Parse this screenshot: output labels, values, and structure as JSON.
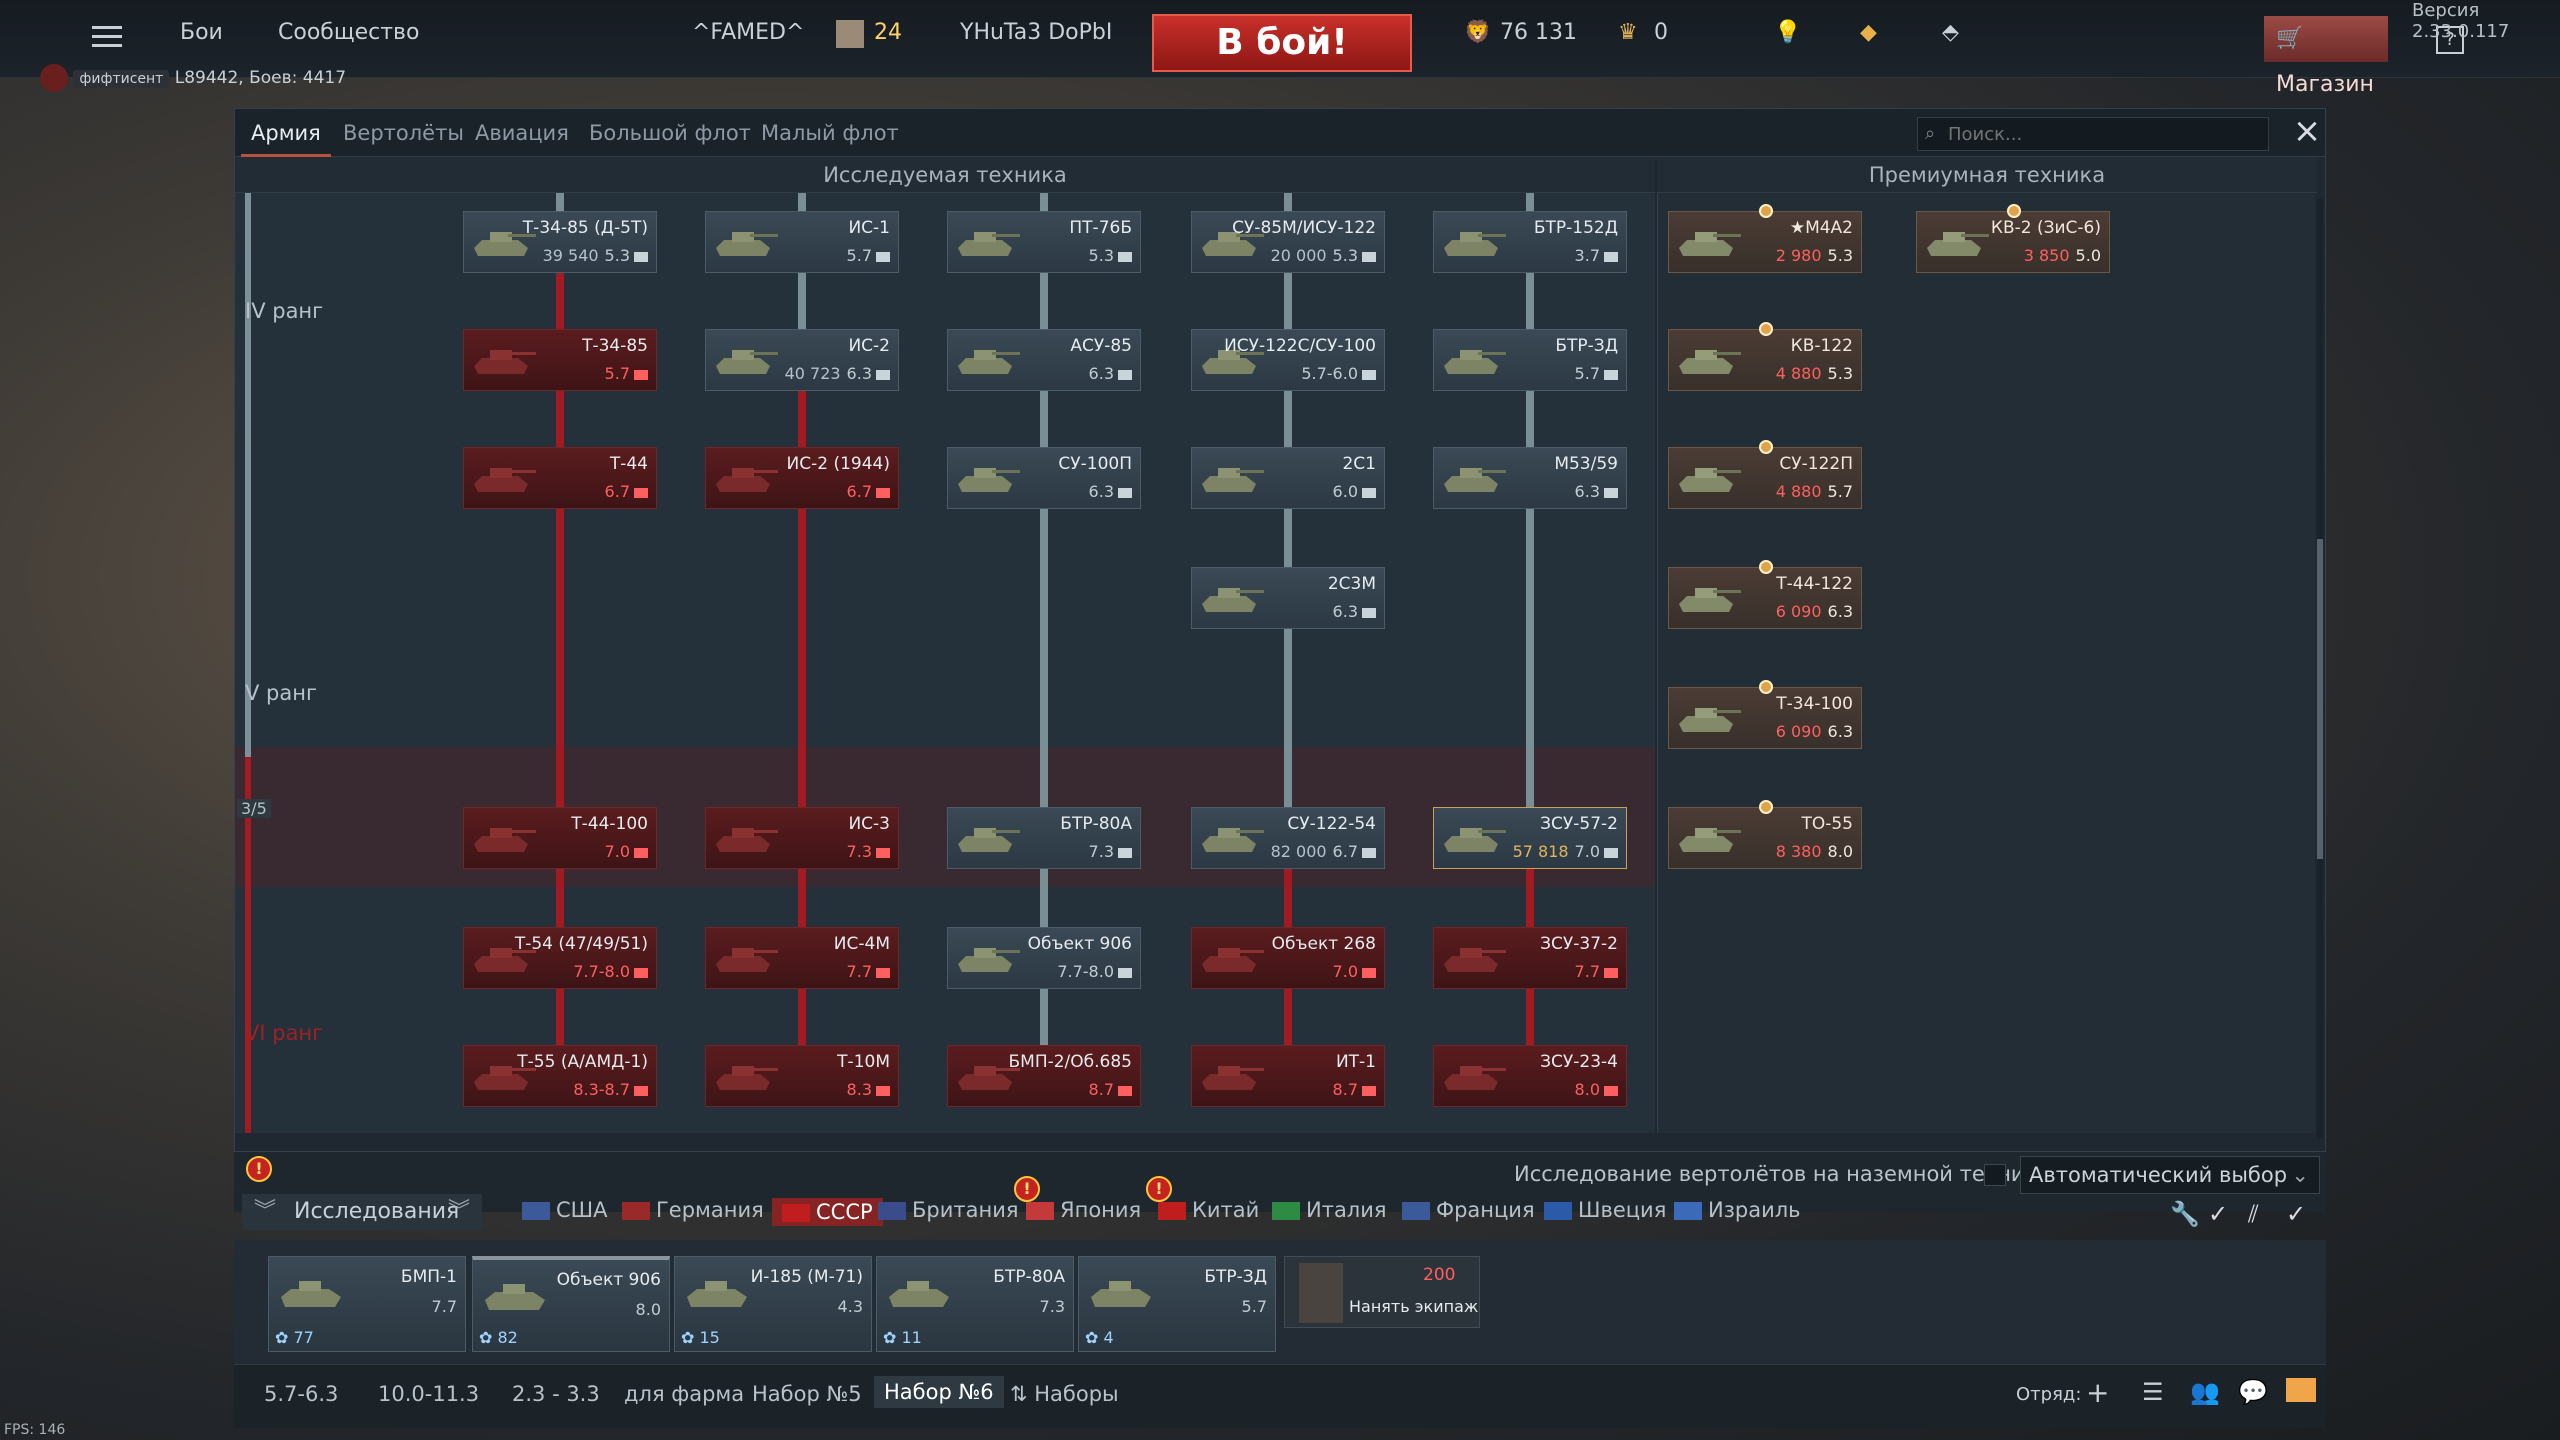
{
  "topbar": {
    "battles": "Бои",
    "community": "Сообщество",
    "squad_tag": "^FAMED^",
    "level": "24",
    "nickname": "YHuTa3 DoPbI",
    "battle_button": "В бой!",
    "silver": "76 131",
    "gold": "0",
    "shop": "Магазин",
    "help": "?",
    "version": "Версия 2.33.0.117",
    "player_tag": "фифтисент",
    "player_stats": "L89442, Боев: 4417"
  },
  "tabs": [
    "Армия",
    "Вертолёты",
    "Авиация",
    "Большой флот",
    "Малый флот"
  ],
  "search": {
    "placeholder": "Поиск..."
  },
  "sections": {
    "researched": "Исследуемая техника",
    "premium": "Премиумная техника"
  },
  "ranks": {
    "iv": "IV ранг",
    "v": "V ранг",
    "vi": "VI ранг",
    "progress": "3/5"
  },
  "tree": [
    {
      "name": "Т-34-85 (Д-5Т)",
      "rp": "39 540",
      "br": "5.3",
      "state": "open"
    },
    {
      "name": "ИС-1",
      "rp": "",
      "br": "5.7",
      "state": "open"
    },
    {
      "name": "ПТ-76Б",
      "rp": "",
      "br": "5.3",
      "state": "open"
    },
    {
      "name": "СУ-85М/ИСУ-122",
      "rp": "20 000",
      "br": "5.3",
      "state": "open"
    },
    {
      "name": "БТР-152Д",
      "rp": "",
      "br": "3.7",
      "state": "open"
    },
    {
      "name": "Т-34-85",
      "rp": "",
      "br": "5.7",
      "state": "locked"
    },
    {
      "name": "ИС-2",
      "rp": "40 723",
      "br": "6.3",
      "state": "open"
    },
    {
      "name": "АСУ-85",
      "rp": "",
      "br": "6.3",
      "state": "open"
    },
    {
      "name": "ИСУ-122С/СУ-100",
      "rp": "",
      "br": "5.7-6.0",
      "state": "open"
    },
    {
      "name": "БТР-ЗД",
      "rp": "",
      "br": "5.7",
      "state": "open"
    },
    {
      "name": "Т-44",
      "rp": "",
      "br": "6.7",
      "state": "locked"
    },
    {
      "name": "ИС-2 (1944)",
      "rp": "",
      "br": "6.7",
      "state": "locked"
    },
    {
      "name": "СУ-100П",
      "rp": "",
      "br": "6.3",
      "state": "open"
    },
    {
      "name": "2С1",
      "rp": "",
      "br": "6.0",
      "state": "open"
    },
    {
      "name": "M53/59",
      "rp": "",
      "br": "6.3",
      "state": "open"
    },
    {
      "name": "2С3М",
      "rp": "",
      "br": "6.3",
      "state": "open"
    },
    {
      "name": "Т-44-100",
      "rp": "",
      "br": "7.0",
      "state": "locked"
    },
    {
      "name": "ИС-3",
      "rp": "",
      "br": "7.3",
      "state": "locked"
    },
    {
      "name": "БТР-80А",
      "rp": "",
      "br": "7.3",
      "state": "open"
    },
    {
      "name": "СУ-122-54",
      "rp": "82 000",
      "br": "6.7",
      "state": "open"
    },
    {
      "name": "ЗСУ-57-2",
      "rp": "57 818",
      "br": "7.0",
      "state": "elite"
    },
    {
      "name": "Т-54 (47/49/51)",
      "rp": "",
      "br": "7.7-8.0",
      "state": "locked"
    },
    {
      "name": "ИС-4М",
      "rp": "",
      "br": "7.7",
      "state": "locked"
    },
    {
      "name": "Объект 906",
      "rp": "",
      "br": "7.7-8.0",
      "state": "open"
    },
    {
      "name": "Объект 268",
      "rp": "",
      "br": "7.0",
      "state": "locked"
    },
    {
      "name": "ЗСУ-37-2",
      "rp": "",
      "br": "7.7",
      "state": "locked"
    },
    {
      "name": "Т-55 (А/АМД-1)",
      "rp": "",
      "br": "8.3-8.7",
      "state": "locked"
    },
    {
      "name": "Т-10М",
      "rp": "",
      "br": "8.3",
      "state": "locked"
    },
    {
      "name": "БМП-2/Об.685",
      "rp": "",
      "br": "8.7",
      "state": "locked"
    },
    {
      "name": "ИТ-1",
      "rp": "",
      "br": "8.7",
      "state": "locked"
    },
    {
      "name": "ЗСУ-23-4",
      "rp": "",
      "br": "8.0",
      "state": "locked"
    }
  ],
  "premium": [
    {
      "name": "★M4A2",
      "price": "2 980",
      "br": "5.3"
    },
    {
      "name": "КВ-2 (ЗиС-6)",
      "price": "3 850",
      "br": "5.0"
    },
    {
      "name": "КВ-122",
      "price": "4 880",
      "br": "5.3"
    },
    {
      "name": "СУ-122П",
      "price": "4 880",
      "br": "5.7"
    },
    {
      "name": "Т-44-122",
      "price": "6 090",
      "br": "6.3"
    },
    {
      "name": "Т-34-100",
      "price": "6 090",
      "br": "6.3"
    },
    {
      "name": "ТО-55",
      "price": "8 380",
      "br": "8.0"
    }
  ],
  "research": {
    "label": "Исследования",
    "heli_text": "Исследование вертолётов на наземной технике",
    "auto": "Автоматический выбор"
  },
  "nations": [
    "США",
    "Германия",
    "СССР",
    "Британия",
    "Япония",
    "Китай",
    "Италия",
    "Франция",
    "Швеция",
    "Израиль"
  ],
  "slots": [
    {
      "name": "БМП-1",
      "br": "7.7",
      "crew": "77"
    },
    {
      "name": "Объект 906",
      "br": "8.0",
      "crew": "82"
    },
    {
      "name": "И-185 (М-71)",
      "br": "4.3",
      "crew": "15"
    },
    {
      "name": "БТР-80А",
      "br": "7.3",
      "crew": "11"
    },
    {
      "name": "БТР-ЗД",
      "br": "5.7",
      "crew": "4"
    }
  ],
  "crew_hire": {
    "price": "200",
    "label": "Нанять экипаж"
  },
  "presets": [
    "5.7-6.3",
    "10.0-11.3",
    "2.3 - 3.3",
    "для фарма",
    "Набор №5",
    "Набор №6",
    "Наборы"
  ],
  "squad_label": "Отряд:",
  "fps": "FPS: 146",
  "colors": {
    "accent": "#b8523f",
    "locked": "#a21b22",
    "premium_price": "#ff5f5f"
  }
}
